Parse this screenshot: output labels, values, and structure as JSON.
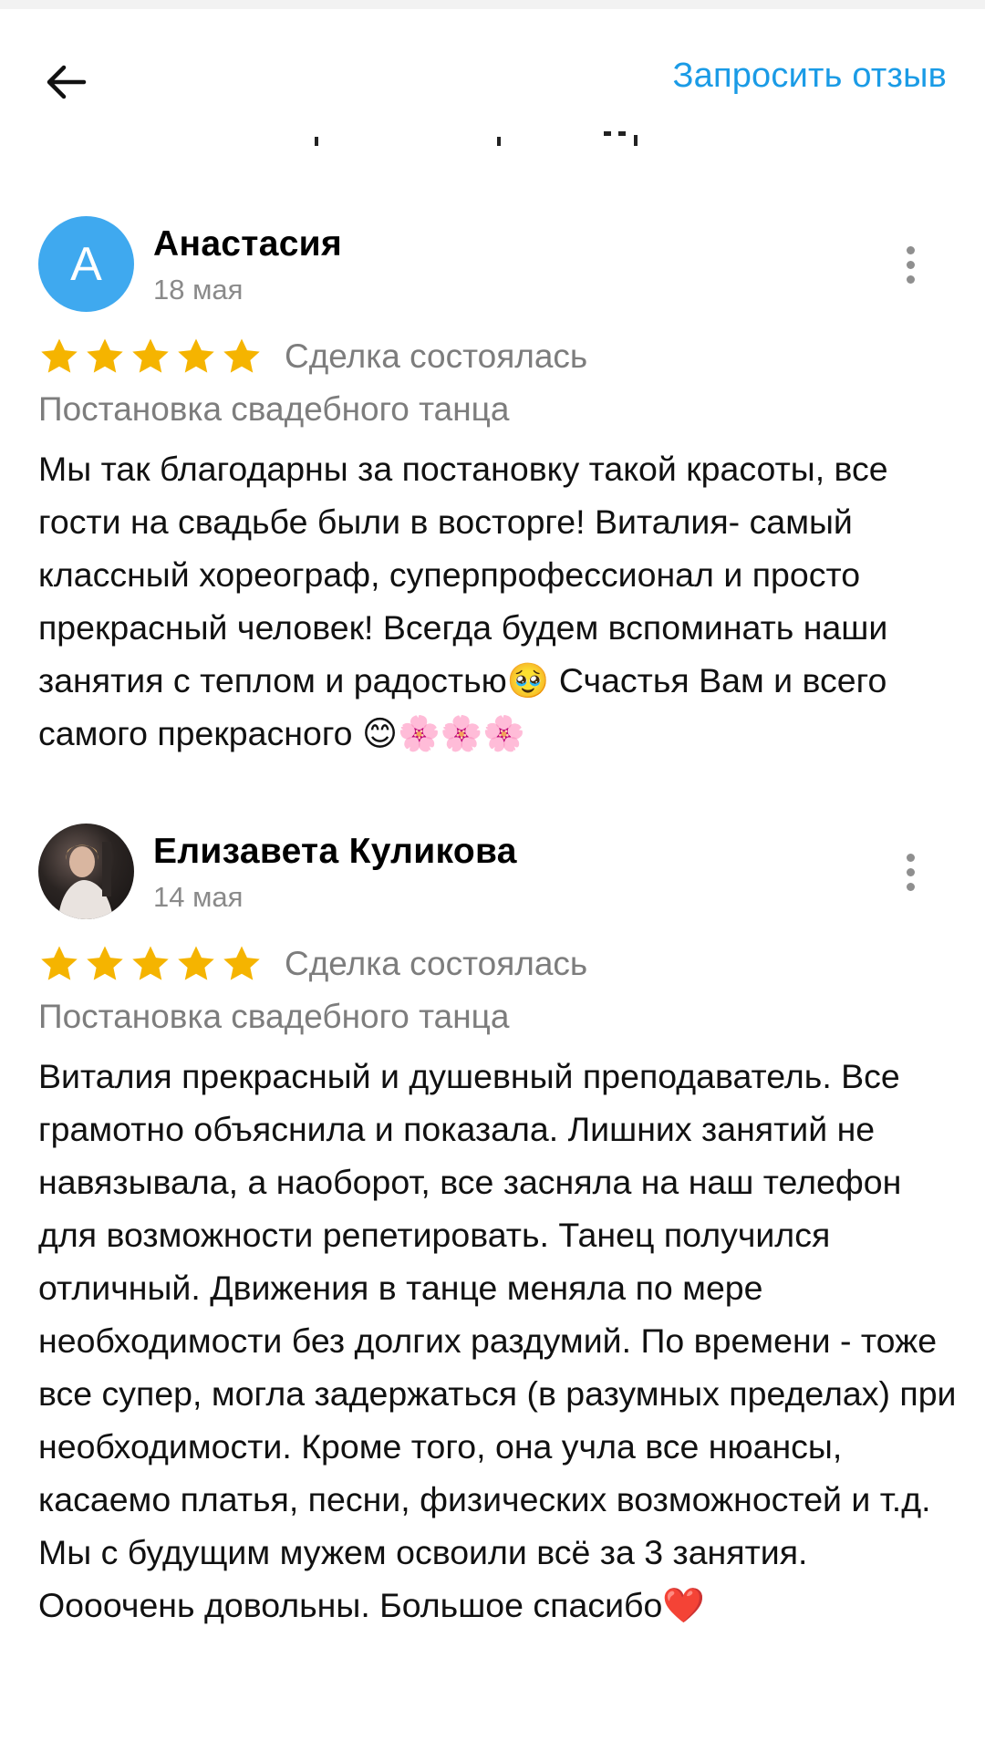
{
  "header": {
    "request_review_label": "Запросить отзыв"
  },
  "icons": {
    "back": "arrow-left-icon",
    "more": "more-vertical-icon",
    "star": "star-icon"
  },
  "colors": {
    "accent": "#1a9be6",
    "star": "#f5b400",
    "avatar_letter_bg": "#3fa9ef",
    "secondary_text": "#7d7d7d"
  },
  "reviews": [
    {
      "avatar_letter": "А",
      "name": "Анастасия",
      "date": "18 мая",
      "rating": 5,
      "status": "Сделка состоялась",
      "service": "Постановка свадебного танца",
      "text": "Мы так благодарны  за постановку такой красоты, все гости на свадьбе были в восторге! Виталия- самый классный хореограф, суперпрофессионал и просто прекрасный человек! Всегда будем вспоминать наши занятия с теплом и радостью🥹 Счастья Вам и всего самого прекрасного 😊🌸🌸🌸"
    },
    {
      "avatar_letter": "",
      "name": "Елизавета Куликова",
      "date": "14 мая",
      "rating": 5,
      "status": "Сделка состоялась",
      "service": "Постановка свадебного танца",
      "text": "Виталия прекрасный и душевный преподаватель. Все грамотно объяснила и показала. Лишних занятий не навязывала, а наоборот, все засняла на наш телефон для возможности репетировать. Танец получился отличный. Движения в танце меняла по мере необходимости без долгих раздумий. По времени - тоже все супер, могла задержаться (в разумных пределах) при необходимости. Кроме того, она учла все нюансы, касаемо платья, песни, физических возможностей и т.д. Мы с будущим мужем освоили всё за 3 занятия. Оооочень довольны. Большое спасибо❤️"
    }
  ]
}
